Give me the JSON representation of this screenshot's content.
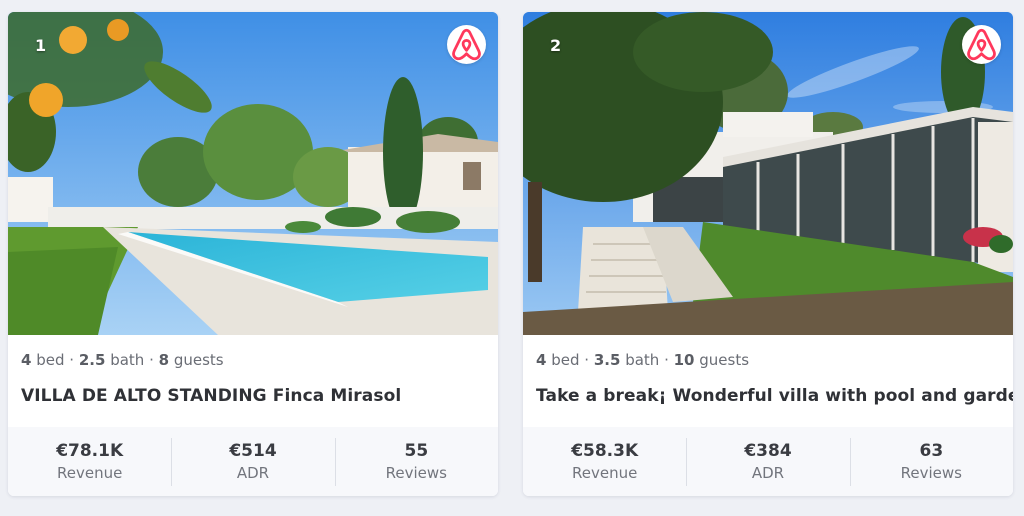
{
  "brand_color": "#ff385c",
  "listings": [
    {
      "rank": "1",
      "platform_icon": "airbnb-icon",
      "bed_count": "4",
      "bed_label": "bed",
      "bath_count": "2.5",
      "bath_label": "bath",
      "guest_count": "8",
      "guest_label": "guests",
      "title": "VILLA DE ALTO STANDING Finca Mirasol",
      "revenue_value": "€78.1K",
      "revenue_label": "Revenue",
      "adr_value": "€514",
      "adr_label": "ADR",
      "reviews_value": "55",
      "reviews_label": "Reviews"
    },
    {
      "rank": "2",
      "platform_icon": "airbnb-icon",
      "bed_count": "4",
      "bed_label": "bed",
      "bath_count": "3.5",
      "bath_label": "bath",
      "guest_count": "10",
      "guest_label": "guests",
      "title": "Take a break¡ Wonderful villa with pool and garden",
      "revenue_value": "€58.3K",
      "revenue_label": "Revenue",
      "adr_value": "€384",
      "adr_label": "ADR",
      "reviews_value": "63",
      "reviews_label": "Reviews"
    }
  ]
}
